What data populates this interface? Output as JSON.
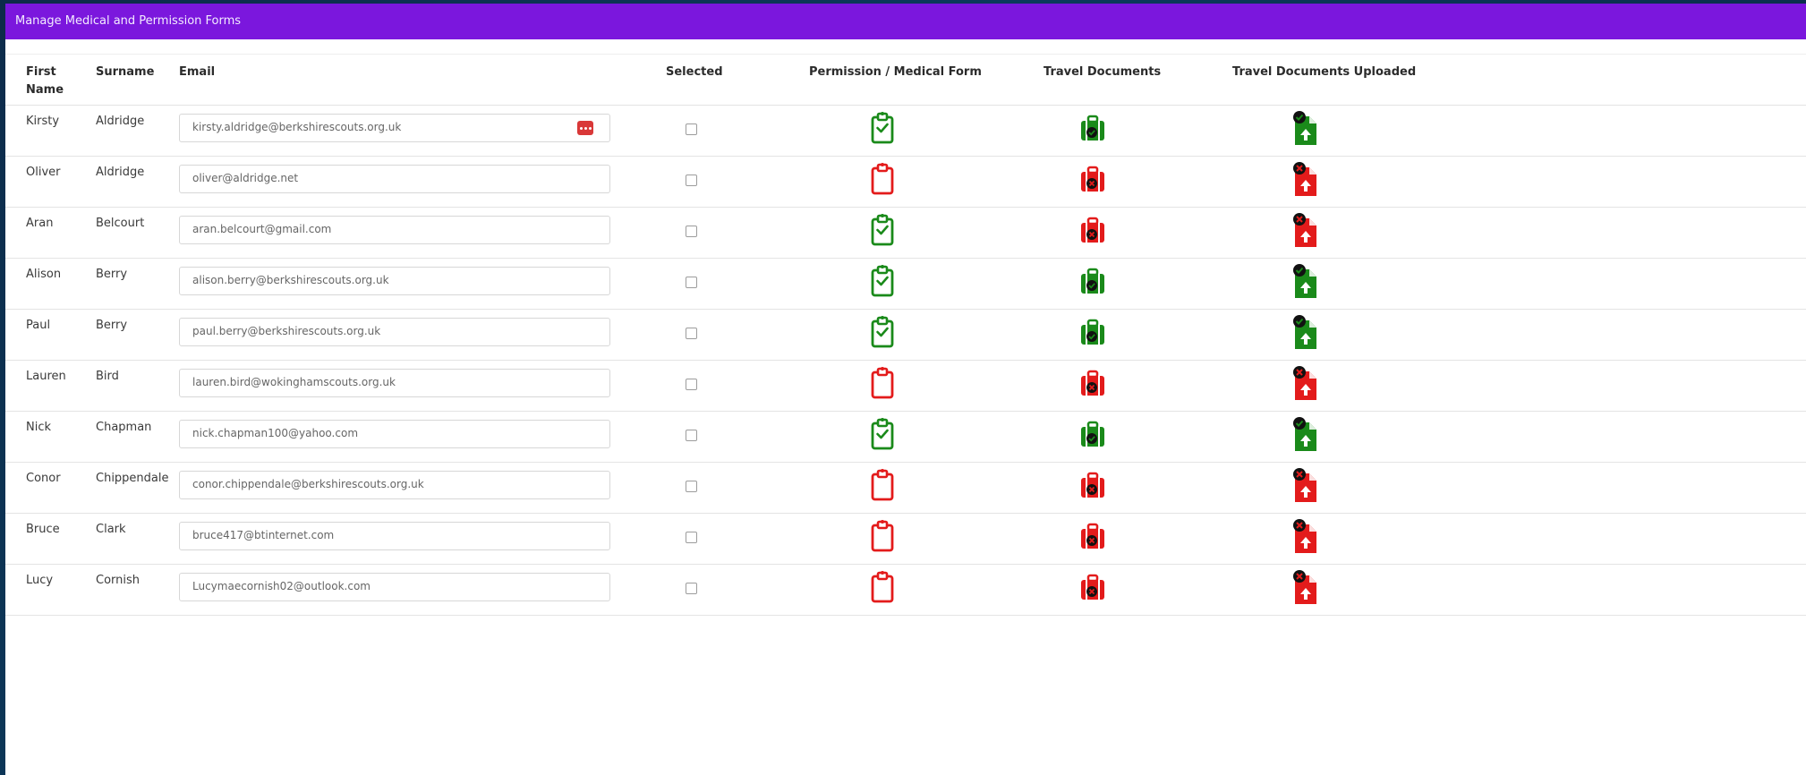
{
  "panel": {
    "title": "Manage Medical and Permission Forms"
  },
  "columns": {
    "first_name": "First Name",
    "surname": "Surname",
    "email": "Email",
    "selected": "Selected",
    "permission": "Permission / Medical Form",
    "travel_docs": "Travel Documents",
    "travel_uploaded": "Travel Documents Uploaded"
  },
  "colors": {
    "header": "#7b17dd",
    "ok": "#1a8a1a",
    "missing": "#e31b1b"
  },
  "rows": [
    {
      "first": "Kirsty",
      "surname": "Aldridge",
      "email": "kirsty.aldridge@berkshirescouts.org.uk",
      "selected": false,
      "permission": "complete",
      "travel": "complete",
      "uploaded": "complete",
      "password_icon": true
    },
    {
      "first": "Oliver",
      "surname": "Aldridge",
      "email": "oliver@aldridge.net",
      "selected": false,
      "permission": "missing",
      "travel": "missing",
      "uploaded": "missing"
    },
    {
      "first": "Aran",
      "surname": "Belcourt",
      "email": "aran.belcourt@gmail.com",
      "selected": false,
      "permission": "complete",
      "travel": "missing",
      "uploaded": "missing"
    },
    {
      "first": "Alison",
      "surname": "Berry",
      "email": "alison.berry@berkshirescouts.org.uk",
      "selected": false,
      "permission": "complete",
      "travel": "complete",
      "uploaded": "complete"
    },
    {
      "first": "Paul",
      "surname": "Berry",
      "email": "paul.berry@berkshirescouts.org.uk",
      "selected": false,
      "permission": "complete",
      "travel": "complete",
      "uploaded": "complete"
    },
    {
      "first": "Lauren",
      "surname": "Bird",
      "email": "lauren.bird@wokinghamscouts.org.uk",
      "selected": false,
      "permission": "missing",
      "travel": "missing",
      "uploaded": "missing"
    },
    {
      "first": "Nick",
      "surname": "Chapman",
      "email": "nick.chapman100@yahoo.com",
      "selected": false,
      "permission": "complete",
      "travel": "complete",
      "uploaded": "complete"
    },
    {
      "first": "Conor",
      "surname": "Chippendale",
      "email": "conor.chippendale@berkshirescouts.org.uk",
      "selected": false,
      "permission": "missing",
      "travel": "missing",
      "uploaded": "missing"
    },
    {
      "first": "Bruce",
      "surname": "Clark",
      "email": "bruce417@btinternet.com",
      "selected": false,
      "permission": "missing",
      "travel": "missing",
      "uploaded": "missing"
    },
    {
      "first": "Lucy",
      "surname": "Cornish",
      "email": "Lucymaecornish02@outlook.com",
      "selected": false,
      "permission": "missing",
      "travel": "missing",
      "uploaded": "missing"
    }
  ]
}
